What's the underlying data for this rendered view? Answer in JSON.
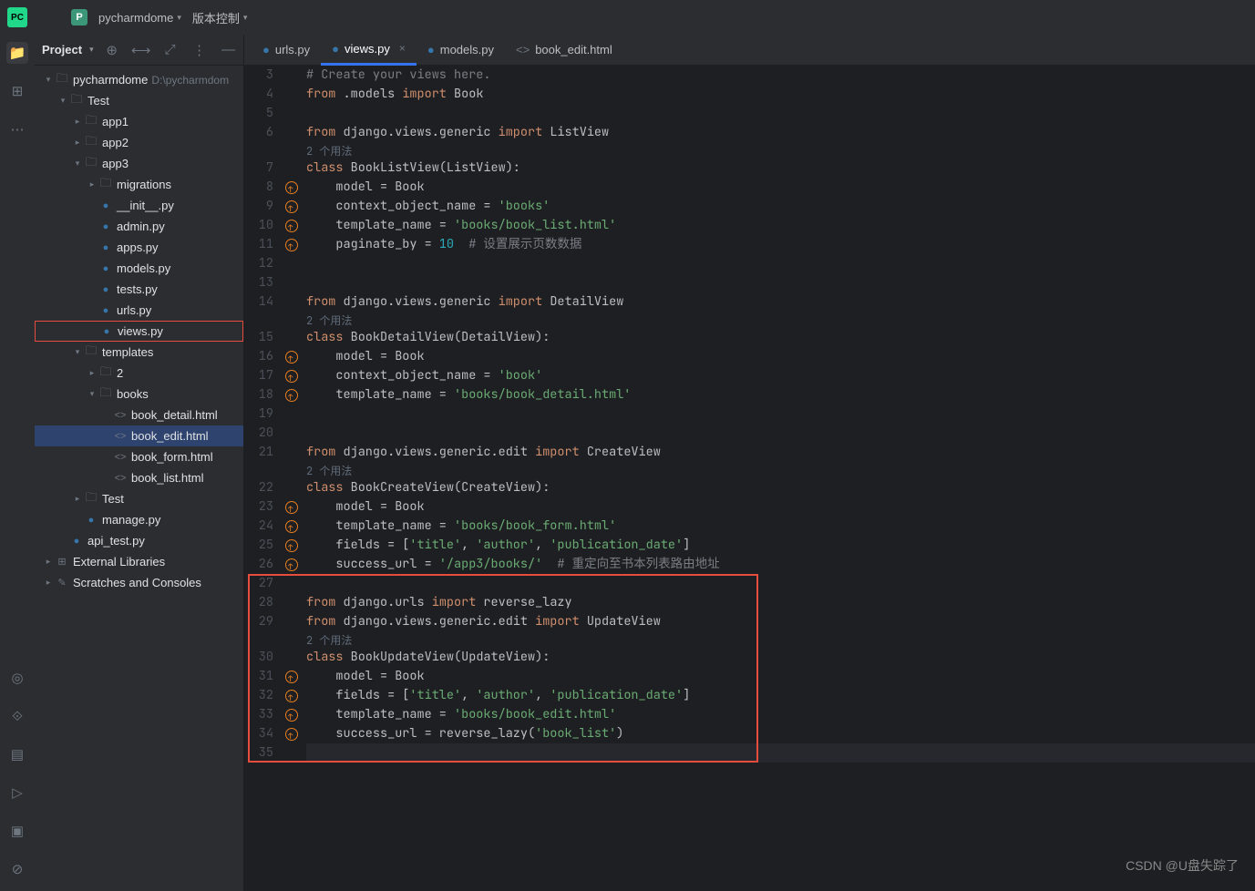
{
  "titlebar": {
    "project": "pycharmdome",
    "menu_vcs": "版本控制"
  },
  "sidebar": {
    "title": "Project",
    "tree": [
      {
        "indent": 0,
        "chev": "▾",
        "icon": "folder",
        "label": "pycharmdome",
        "path": "D:\\pycharmdom"
      },
      {
        "indent": 1,
        "chev": "▾",
        "icon": "folder",
        "label": "Test"
      },
      {
        "indent": 2,
        "chev": "▸",
        "icon": "folder",
        "label": "app1"
      },
      {
        "indent": 2,
        "chev": "▸",
        "icon": "folder",
        "label": "app2"
      },
      {
        "indent": 2,
        "chev": "▾",
        "icon": "folder",
        "label": "app3"
      },
      {
        "indent": 3,
        "chev": "▸",
        "icon": "pkg",
        "label": "migrations"
      },
      {
        "indent": 3,
        "chev": "",
        "icon": "py",
        "label": "__init__.py"
      },
      {
        "indent": 3,
        "chev": "",
        "icon": "py",
        "label": "admin.py"
      },
      {
        "indent": 3,
        "chev": "",
        "icon": "py",
        "label": "apps.py"
      },
      {
        "indent": 3,
        "chev": "",
        "icon": "py",
        "label": "models.py"
      },
      {
        "indent": 3,
        "chev": "",
        "icon": "py",
        "label": "tests.py"
      },
      {
        "indent": 3,
        "chev": "",
        "icon": "py",
        "label": "urls.py"
      },
      {
        "indent": 3,
        "chev": "",
        "icon": "py",
        "label": "views.py",
        "highlighted": true
      },
      {
        "indent": 2,
        "chev": "▾",
        "icon": "folder",
        "label": "templates"
      },
      {
        "indent": 3,
        "chev": "▸",
        "icon": "folder",
        "label": "2"
      },
      {
        "indent": 3,
        "chev": "▾",
        "icon": "folder",
        "label": "books"
      },
      {
        "indent": 4,
        "chev": "",
        "icon": "html",
        "label": "book_detail.html"
      },
      {
        "indent": 4,
        "chev": "",
        "icon": "html",
        "label": "book_edit.html",
        "selected": true
      },
      {
        "indent": 4,
        "chev": "",
        "icon": "html",
        "label": "book_form.html"
      },
      {
        "indent": 4,
        "chev": "",
        "icon": "html",
        "label": "book_list.html"
      },
      {
        "indent": 2,
        "chev": "▸",
        "icon": "pkg",
        "label": "Test"
      },
      {
        "indent": 2,
        "chev": "",
        "icon": "py",
        "label": "manage.py"
      },
      {
        "indent": 1,
        "chev": "",
        "icon": "py",
        "label": "api_test.py"
      },
      {
        "indent": 0,
        "chev": "▸",
        "icon": "lib",
        "label": "External Libraries"
      },
      {
        "indent": 0,
        "chev": "▸",
        "icon": "scratch",
        "label": "Scratches and Consoles"
      }
    ]
  },
  "tabs": [
    {
      "icon": "py",
      "label": "urls.py"
    },
    {
      "icon": "py",
      "label": "views.py",
      "active": true,
      "close": true
    },
    {
      "icon": "py",
      "label": "models.py"
    },
    {
      "icon": "html",
      "label": "book_edit.html"
    }
  ],
  "usage": "2 个用法",
  "code": {
    "lines": [
      {
        "n": 3,
        "seg": [
          {
            "c": "cmt",
            "t": "# Create your views here."
          }
        ]
      },
      {
        "n": 4,
        "seg": [
          {
            "c": "kw",
            "t": "from"
          },
          {
            "t": " .models "
          },
          {
            "c": "kw",
            "t": "import"
          },
          {
            "t": " Book"
          }
        ]
      },
      {
        "n": 5,
        "seg": []
      },
      {
        "n": 6,
        "seg": [
          {
            "c": "kw",
            "t": "from"
          },
          {
            "t": " django.views.generic "
          },
          {
            "c": "kw",
            "t": "import"
          },
          {
            "t": " ListView"
          }
        ]
      },
      {
        "usage": true
      },
      {
        "n": 7,
        "seg": [
          {
            "c": "kw",
            "t": "class "
          },
          {
            "c": "cls",
            "t": "BookListView"
          },
          {
            "t": "(ListView):"
          }
        ]
      },
      {
        "n": 8,
        "mark": true,
        "seg": [
          {
            "t": "    model = Book"
          }
        ]
      },
      {
        "n": 9,
        "mark": true,
        "seg": [
          {
            "t": "    context_object_name = "
          },
          {
            "c": "str",
            "t": "'books'"
          }
        ]
      },
      {
        "n": 10,
        "mark": true,
        "seg": [
          {
            "t": "    template_name = "
          },
          {
            "c": "str",
            "t": "'books/book_list.html'"
          }
        ]
      },
      {
        "n": 11,
        "mark": true,
        "seg": [
          {
            "t": "    paginate_by = "
          },
          {
            "c": "num",
            "t": "10  "
          },
          {
            "c": "cmt",
            "t": "# 设置展示页数数据"
          }
        ]
      },
      {
        "n": 12,
        "seg": []
      },
      {
        "n": 13,
        "seg": []
      },
      {
        "n": 14,
        "seg": [
          {
            "c": "kw",
            "t": "from"
          },
          {
            "t": " django.views.generic "
          },
          {
            "c": "kw",
            "t": "import"
          },
          {
            "t": " DetailView"
          }
        ]
      },
      {
        "usage": true
      },
      {
        "n": 15,
        "seg": [
          {
            "c": "kw",
            "t": "class "
          },
          {
            "c": "cls",
            "t": "BookDetailView"
          },
          {
            "t": "(DetailView):"
          }
        ]
      },
      {
        "n": 16,
        "mark": true,
        "seg": [
          {
            "t": "    model = Book"
          }
        ]
      },
      {
        "n": 17,
        "mark": true,
        "seg": [
          {
            "t": "    context_object_name = "
          },
          {
            "c": "str",
            "t": "'book'"
          }
        ]
      },
      {
        "n": 18,
        "mark": true,
        "seg": [
          {
            "t": "    template_name = "
          },
          {
            "c": "str",
            "t": "'books/book_detail.html'"
          }
        ]
      },
      {
        "n": 19,
        "seg": []
      },
      {
        "n": 20,
        "seg": []
      },
      {
        "n": 21,
        "seg": [
          {
            "c": "kw",
            "t": "from"
          },
          {
            "t": " django.views.generic.edit "
          },
          {
            "c": "kw",
            "t": "import"
          },
          {
            "t": " CreateView"
          }
        ]
      },
      {
        "usage": true
      },
      {
        "n": 22,
        "seg": [
          {
            "c": "kw",
            "t": "class "
          },
          {
            "c": "cls",
            "t": "BookCreateView"
          },
          {
            "t": "(CreateView):"
          }
        ]
      },
      {
        "n": 23,
        "mark": true,
        "seg": [
          {
            "t": "    model = Book"
          }
        ]
      },
      {
        "n": 24,
        "mark": true,
        "seg": [
          {
            "t": "    template_name = "
          },
          {
            "c": "str",
            "t": "'books/book_form.html'"
          }
        ]
      },
      {
        "n": 25,
        "mark": true,
        "seg": [
          {
            "t": "    fields = ["
          },
          {
            "c": "str",
            "t": "'title'"
          },
          {
            "t": ", "
          },
          {
            "c": "str",
            "t": "'author'"
          },
          {
            "t": ", "
          },
          {
            "c": "str",
            "t": "'publication_date'"
          },
          {
            "t": "]"
          }
        ]
      },
      {
        "n": 26,
        "mark": true,
        "seg": [
          {
            "t": "    success_url = "
          },
          {
            "c": "str",
            "t": "'/app3/books/'  "
          },
          {
            "c": "cmt",
            "t": "# 重定向至书本列表路由地址"
          }
        ]
      },
      {
        "n": 27,
        "seg": [],
        "redtop": true
      },
      {
        "n": 28,
        "seg": [
          {
            "c": "kw",
            "t": "from"
          },
          {
            "t": " django.urls "
          },
          {
            "c": "kw",
            "t": "import"
          },
          {
            "t": " reverse_lazy"
          }
        ],
        "red": true
      },
      {
        "n": 29,
        "seg": [
          {
            "c": "kw",
            "t": "from"
          },
          {
            "t": " django.views.generic.edit "
          },
          {
            "c": "kw",
            "t": "import"
          },
          {
            "t": " UpdateView"
          }
        ],
        "red": true
      },
      {
        "usage": true,
        "red": true
      },
      {
        "n": 30,
        "seg": [
          {
            "c": "kw",
            "t": "class "
          },
          {
            "c": "cls",
            "t": "BookUpdateView"
          },
          {
            "t": "(UpdateView):"
          }
        ],
        "red": true
      },
      {
        "n": 31,
        "mark": true,
        "seg": [
          {
            "t": "    model = Book"
          }
        ],
        "red": true
      },
      {
        "n": 32,
        "mark": true,
        "seg": [
          {
            "t": "    fields = ["
          },
          {
            "c": "str",
            "t": "'title'"
          },
          {
            "t": ", "
          },
          {
            "c": "str",
            "t": "'author'"
          },
          {
            "t": ", "
          },
          {
            "c": "str",
            "t": "'publication_date'"
          },
          {
            "t": "]"
          }
        ],
        "red": true
      },
      {
        "n": 33,
        "mark": true,
        "seg": [
          {
            "t": "    template_name = "
          },
          {
            "c": "str",
            "t": "'books/book_edit.html'"
          }
        ],
        "red": true
      },
      {
        "n": 34,
        "mark": true,
        "seg": [
          {
            "t": "    success_url = reverse_lazy("
          },
          {
            "c": "str",
            "t": "'book_list'"
          },
          {
            "t": ")"
          }
        ],
        "red": true
      },
      {
        "n": 35,
        "seg": [],
        "caret": true,
        "redbot": true
      }
    ]
  },
  "watermark": "CSDN @U盘失踪了"
}
